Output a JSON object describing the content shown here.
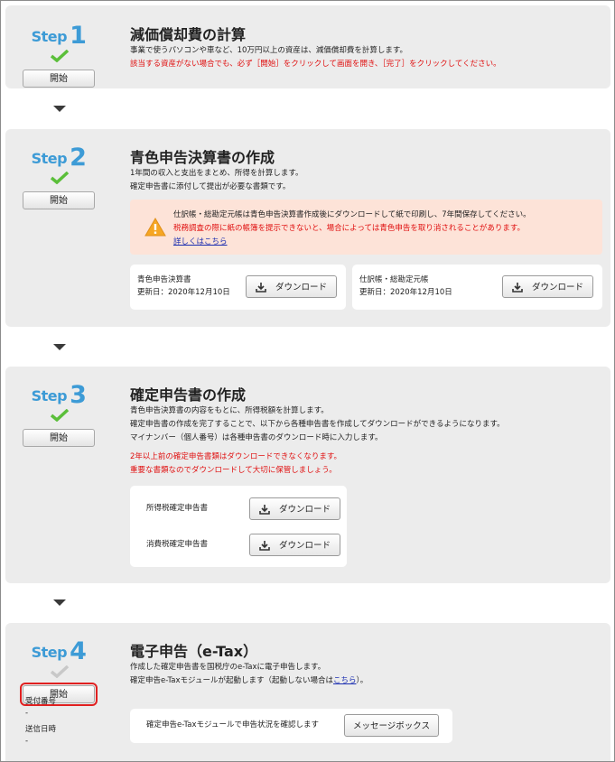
{
  "step_word": "Step",
  "start_label": "開始",
  "download_label": "ダウンロード",
  "steps": [
    {
      "number": "1",
      "status": "complete",
      "title": "減価償却費の計算",
      "desc1": "事業で使うパソコンや車など、10万円以上の資産は、減価償却費を計算します。",
      "desc2": "該当する資産がない場合でも、必ず［開始］をクリックして画面を開き、［完了］をクリックしてください。"
    },
    {
      "number": "2",
      "status": "complete",
      "title": "青色申告決算書の作成",
      "desc1": "1年間の収入と支出をまとめ、所得を計算します。",
      "desc2": "確定申告書に添付して提出が必要な書類です。",
      "warning": {
        "line1": "仕訳帳・総勘定元帳は青色申告決算書作成後にダウンロードして紙で印刷し、7年間保存してください。",
        "line2": "税務調査の際に紙の帳簿を提示できないと、場合によっては青色申告を取り消されることがあります。",
        "link": "詳しくはこちら"
      },
      "docs": [
        {
          "name": "青色申告決算書",
          "updated": "更新日：2020年12月10日"
        },
        {
          "name": "仕訳帳・総勘定元帳",
          "updated": "更新日：2020年12月10日"
        }
      ]
    },
    {
      "number": "3",
      "status": "complete",
      "title": "確定申告書の作成",
      "desc1": "青色申告決算書の内容をもとに、所得税額を計算します。",
      "desc2": "確定申告書の作成を完了することで、以下から各種申告書を作成してダウンロードができるようになります。",
      "desc3": "マイナンバー（個人番号）は各種申告書のダウンロード時に入力します。",
      "notice1": "2年以上前の確定申告書類はダウンロードできなくなります。",
      "notice2": "重要な書類なのでダウンロードして大切に保管しましょう。",
      "docs": [
        {
          "name": "所得税確定申告書"
        },
        {
          "name": "消費税確定申告書"
        }
      ]
    },
    {
      "number": "4",
      "status": "incomplete",
      "title": "電子申告（e-Tax）",
      "desc1": "作成した確定申告書を国税庁のe-Taxに電子申告します。",
      "desc2_pre": "確定申告e-Taxモジュールが起動します（起動しない場合は",
      "desc2_link": "こちら",
      "desc2_post": "）。",
      "receipt_label": "受付番号",
      "receipt_value": "-",
      "sent_label": "送信日時",
      "sent_value": "-",
      "message_text": "確定申告e-Taxモジュールで申告状況を確認します",
      "message_button": "メッセージボックス"
    }
  ],
  "colors": {
    "step_blue": "#3d9bd6",
    "check_green": "#5bbf3a",
    "check_gray": "#c8c8c8",
    "alert_red": "#e01010",
    "warning_bg": "#fde3d8",
    "panel_bg": "#ececec"
  },
  "icons": [
    "check-icon",
    "warning-icon",
    "download-icon",
    "arrow-down-icon"
  ]
}
